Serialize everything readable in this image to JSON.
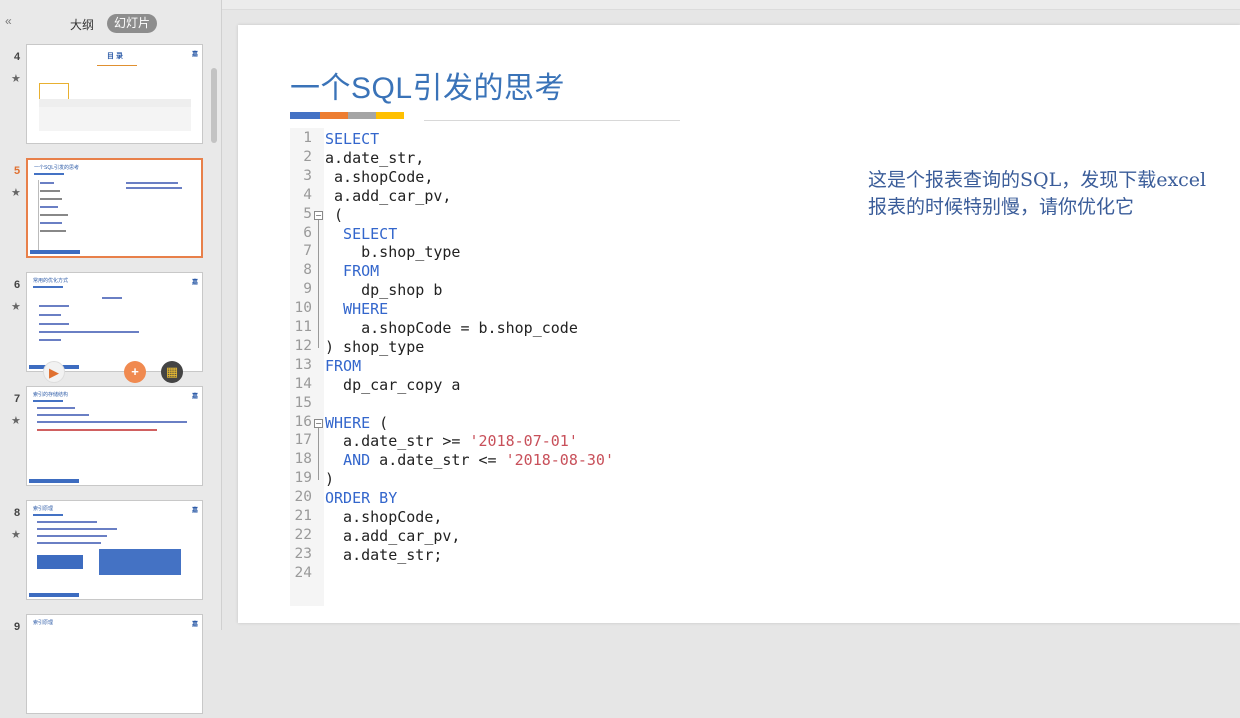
{
  "sidebar": {
    "collapse_icon": "«",
    "tab_outline": "大纲",
    "tab_slides": "幻灯片",
    "star_icon": "★"
  },
  "thumbnails": [
    {
      "number": "4",
      "title": "目 录"
    },
    {
      "number": "5",
      "title": "一个SQL引发的思考"
    },
    {
      "number": "6",
      "title": "常用的优化方式"
    },
    {
      "number": "7",
      "title": "索引的存储结构"
    },
    {
      "number": "8",
      "title": "索引原理"
    },
    {
      "number": "9",
      "title": "索引原理"
    }
  ],
  "overlay": {
    "play_icon": "▶",
    "add_icon": "+",
    "menu_icon": "▦"
  },
  "slide": {
    "title": "一个SQL引发的思考",
    "title_bar_colors": [
      "#4472c4",
      "#ed7d31",
      "#a5a5a5",
      "#ffc000"
    ],
    "note": "这是个报表查询的SQL，发现下载excel报表的时候特别慢，请你优化它",
    "code_lines": [
      {
        "n": "1",
        "text": "SELECT",
        "kw": true
      },
      {
        "n": "2",
        "text": "a.date_str,"
      },
      {
        "n": "3",
        "text": " a.shopCode,"
      },
      {
        "n": "4",
        "text": " a.add_car_pv,"
      },
      {
        "n": "5",
        "text": " ("
      },
      {
        "n": "6",
        "text": "  SELECT",
        "kw": true
      },
      {
        "n": "7",
        "text": "    b.shop_type"
      },
      {
        "n": "8",
        "text": "  FROM",
        "kw": true
      },
      {
        "n": "9",
        "text": "    dp_shop b"
      },
      {
        "n": "10",
        "text": "  WHERE",
        "kw": true
      },
      {
        "n": "11",
        "text": "    a.shopCode = b.shop_code"
      },
      {
        "n": "12",
        "text": ") shop_type"
      },
      {
        "n": "13",
        "text": "FROM",
        "kw": true
      },
      {
        "n": "14",
        "text": "  dp_car_copy a"
      },
      {
        "n": "15",
        "text": ""
      },
      {
        "n": "16",
        "text": "WHERE (",
        "kwPrefix": "WHERE",
        "rest": " ("
      },
      {
        "n": "17",
        "text": "  a.date_str >= '2018-07-01'",
        "pre": "  a.date_str >= ",
        "str": "'2018-07-01'"
      },
      {
        "n": "18",
        "text": "  AND a.date_str <= '2018-08-30'",
        "kwPre": "  ",
        "kwWord": "AND",
        "mid": " a.date_str <= ",
        "str": "'2018-08-30'"
      },
      {
        "n": "19",
        "text": ")"
      },
      {
        "n": "20",
        "text": "ORDER BY",
        "kw": true
      },
      {
        "n": "21",
        "text": "  a.shopCode,"
      },
      {
        "n": "22",
        "text": "  a.add_car_pv,"
      },
      {
        "n": "23",
        "text": "  a.date_str;"
      },
      {
        "n": "24",
        "text": ""
      }
    ]
  }
}
